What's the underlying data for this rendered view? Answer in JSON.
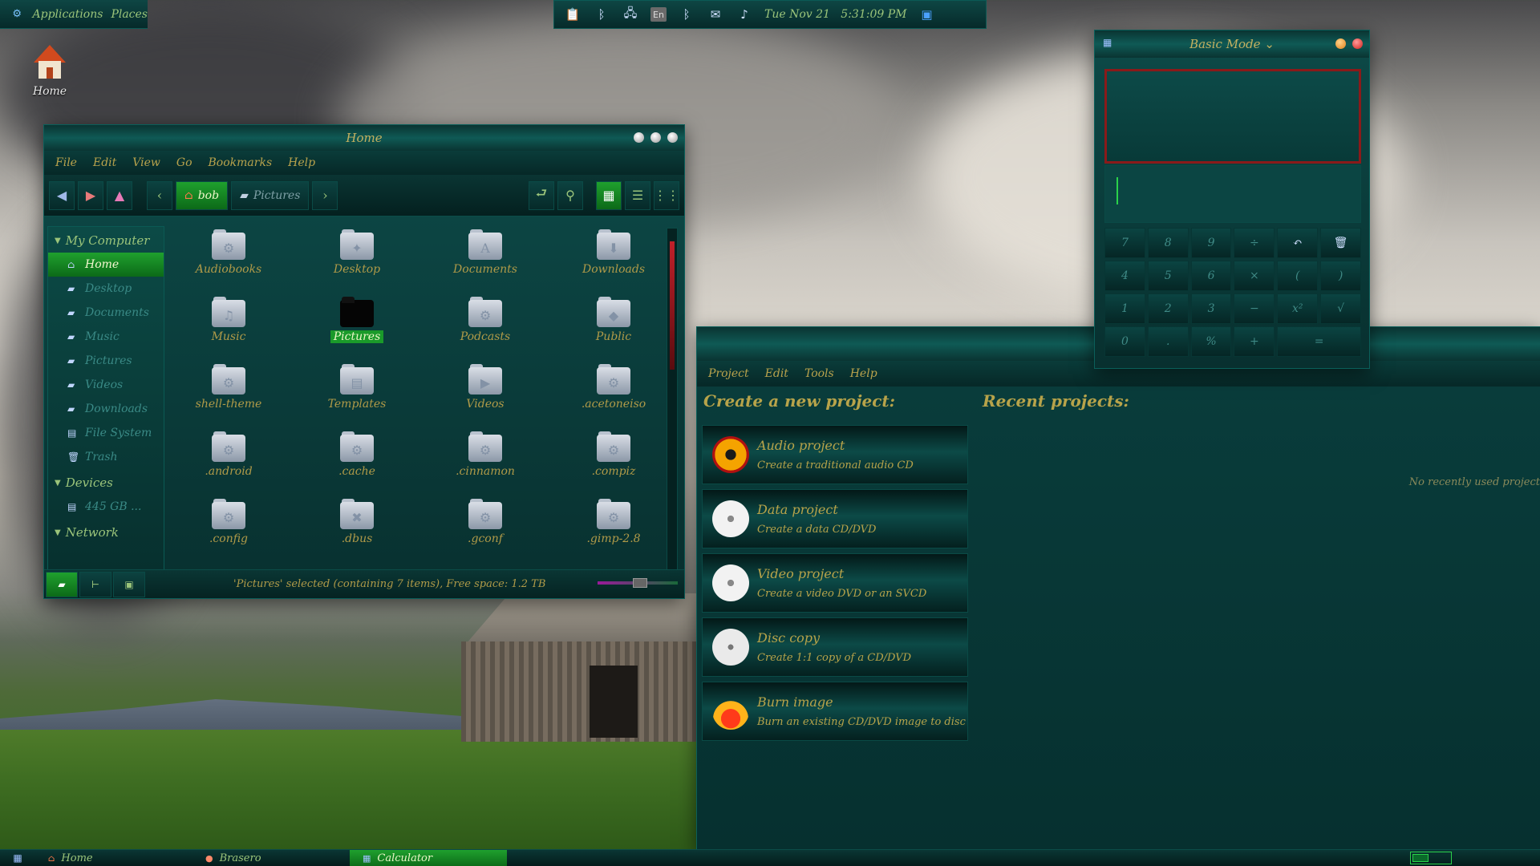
{
  "top_panel": {
    "applications_label": "Applications",
    "places_label": "Places",
    "tray": {
      "keyboard_layout": "En",
      "datetime": "Tue Nov 21   5:31:09 PM"
    }
  },
  "desktop": {
    "home_icon_label": "Home"
  },
  "file_manager": {
    "title": "Home",
    "menu": [
      "File",
      "Edit",
      "View",
      "Go",
      "Bookmarks",
      "Help"
    ],
    "breadcrumbs": [
      "bob",
      "Pictures"
    ],
    "sidebar": {
      "sections": [
        {
          "label": "My Computer",
          "items": [
            {
              "label": "Home",
              "icon": "home-icon",
              "active": true
            },
            {
              "label": "Desktop",
              "icon": "desktop-icon"
            },
            {
              "label": "Documents",
              "icon": "folder-icon"
            },
            {
              "label": "Music",
              "icon": "folder-icon"
            },
            {
              "label": "Pictures",
              "icon": "folder-icon"
            },
            {
              "label": "Videos",
              "icon": "folder-icon"
            },
            {
              "label": "Downloads",
              "icon": "folder-icon"
            },
            {
              "label": "File System",
              "icon": "drive-icon"
            },
            {
              "label": "Trash",
              "icon": "trash-icon"
            }
          ]
        },
        {
          "label": "Devices",
          "items": [
            {
              "label": "445 GB ...",
              "icon": "drive-icon"
            }
          ]
        },
        {
          "label": "Network",
          "items": []
        }
      ]
    },
    "files": [
      {
        "name": "Audiobooks",
        "glyph": "⚙"
      },
      {
        "name": "Desktop",
        "glyph": "✦"
      },
      {
        "name": "Documents",
        "glyph": "A"
      },
      {
        "name": "Downloads",
        "glyph": "⬇"
      },
      {
        "name": "Music",
        "glyph": "♫"
      },
      {
        "name": "Pictures",
        "glyph": "",
        "selected": true
      },
      {
        "name": "Podcasts",
        "glyph": "⚙"
      },
      {
        "name": "Public",
        "glyph": "◆"
      },
      {
        "name": "shell-theme",
        "glyph": "⚙"
      },
      {
        "name": "Templates",
        "glyph": "▤"
      },
      {
        "name": "Videos",
        "glyph": "▶"
      },
      {
        "name": ".acetoneiso",
        "glyph": "⚙"
      },
      {
        "name": ".android",
        "glyph": "⚙"
      },
      {
        "name": ".cache",
        "glyph": "⚙"
      },
      {
        "name": ".cinnamon",
        "glyph": "⚙"
      },
      {
        "name": ".compiz",
        "glyph": "⚙"
      },
      {
        "name": ".config",
        "glyph": "⚙"
      },
      {
        "name": ".dbus",
        "glyph": "✖"
      },
      {
        "name": ".gconf",
        "glyph": "⚙"
      },
      {
        "name": ".gimp-2.8",
        "glyph": "⚙"
      }
    ],
    "status": "'Pictures' selected (containing 7 items), Free space: 1.2 TB"
  },
  "brasero": {
    "menu": [
      "Project",
      "Edit",
      "Tools",
      "Help"
    ],
    "create_title": "Create a new project:",
    "recent_title": "Recent projects:",
    "recent_empty": "No recently used project",
    "projects": [
      {
        "title": "Audio project",
        "subtitle": "Create a traditional audio CD",
        "icon": "radiation-icon"
      },
      {
        "title": "Data project",
        "subtitle": "Create a data CD/DVD",
        "icon": "data-disc-icon"
      },
      {
        "title": "Video project",
        "subtitle": "Create a video DVD or an SVCD",
        "icon": "video-disc-icon"
      },
      {
        "title": "Disc copy",
        "subtitle": "Create 1:1 copy of a CD/DVD",
        "icon": "disc-icon"
      },
      {
        "title": "Burn image",
        "subtitle": "Burn an existing CD/DVD image to disc",
        "icon": "burn-icon"
      }
    ]
  },
  "calculator": {
    "mode_label": "Basic Mode",
    "keys": [
      [
        "7",
        "8",
        "9",
        "÷",
        "undo",
        "clear"
      ],
      [
        "4",
        "5",
        "6",
        "×",
        "(",
        ")"
      ],
      [
        "1",
        "2",
        "3",
        "−",
        "x²",
        "√"
      ],
      [
        "0",
        ".",
        "%",
        "+",
        "="
      ]
    ]
  },
  "taskbar": {
    "tasks": [
      {
        "label": "Home",
        "active": false
      },
      {
        "label": "Brasero",
        "active": false
      },
      {
        "label": "Calculator",
        "active": true
      }
    ]
  },
  "colors": {
    "accent_green": "#1fa02e",
    "window_teal": "#0d4a48",
    "label_gold": "#b7a34a"
  }
}
